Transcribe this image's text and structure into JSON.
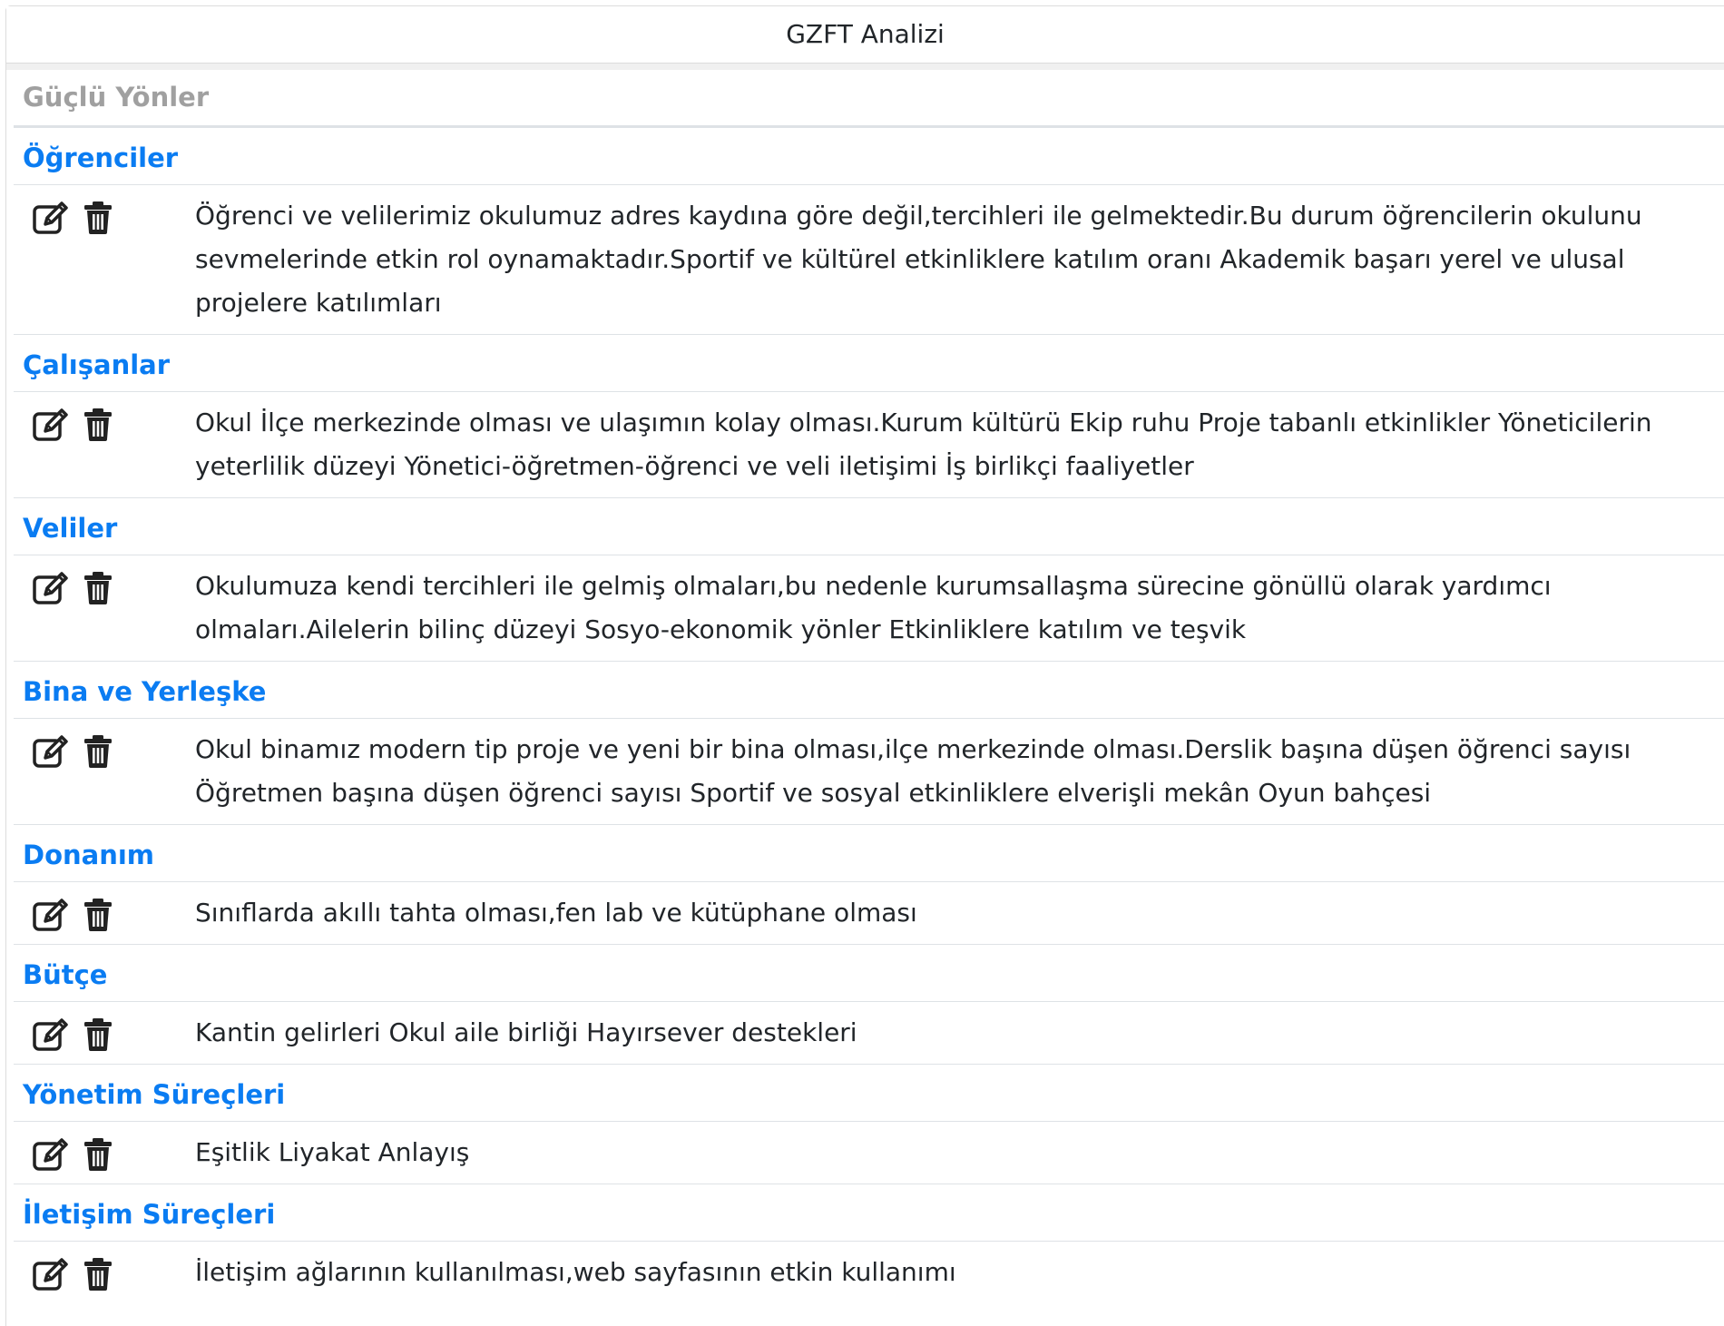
{
  "header": {
    "title": "GZFT Analizi"
  },
  "section": {
    "title": "Güçlü Yönler"
  },
  "icons": {
    "edit": "edit-icon",
    "delete": "trash-icon"
  },
  "colors": {
    "group_title": "#0a7cf2",
    "section_title": "#a0a0a0"
  },
  "groups": [
    {
      "title": "Öğrenciler",
      "text": "Öğrenci ve velilerimiz okulumuz adres kaydına göre değil,tercihleri ile gelmektedir.Bu durum öğrencilerin okulunu sevmelerinde etkin rol oynamaktadır.Sportif ve kültürel etkinliklere katılım oranı Akademik başarı yerel ve ulusal projelere katılımları"
    },
    {
      "title": "Çalışanlar",
      "text": "Okul İlçe merkezinde olması ve ulaşımın kolay olması.Kurum kültürü Ekip ruhu Proje tabanlı etkinlikler Yöneticilerin yeterlilik düzeyi Yönetici-öğretmen-öğrenci ve veli iletişimi İş birlikçi faaliyetler"
    },
    {
      "title": "Veliler",
      "text": "Okulumuza kendi tercihleri ile gelmiş olmaları,bu nedenle kurumsallaşma sürecine gönüllü olarak yardımcı olmaları.Ailelerin bilinç düzeyi Sosyo-ekonomik yönler Etkinliklere katılım ve teşvik"
    },
    {
      "title": "Bina ve Yerleşke",
      "text": "Okul binamız modern tip proje ve yeni bir bina olması,ilçe merkezinde olması.Derslik başına düşen öğrenci sayısı Öğretmen başına düşen öğrenci sayısı Sportif ve sosyal etkinliklere elverişli mekân Oyun bahçesi"
    },
    {
      "title": "Donanım",
      "text": "Sınıflarda akıllı tahta olması,fen lab ve kütüphane olması"
    },
    {
      "title": "Bütçe",
      "text": "Kantin gelirleri Okul aile birliği Hayırsever destekleri"
    },
    {
      "title": "Yönetim Süreçleri",
      "text": "Eşitlik Liyakat Anlayış"
    },
    {
      "title": "İletişim Süreçleri",
      "text": "İletişim ağlarının kullanılması,web sayfasının etkin kullanımı"
    }
  ]
}
